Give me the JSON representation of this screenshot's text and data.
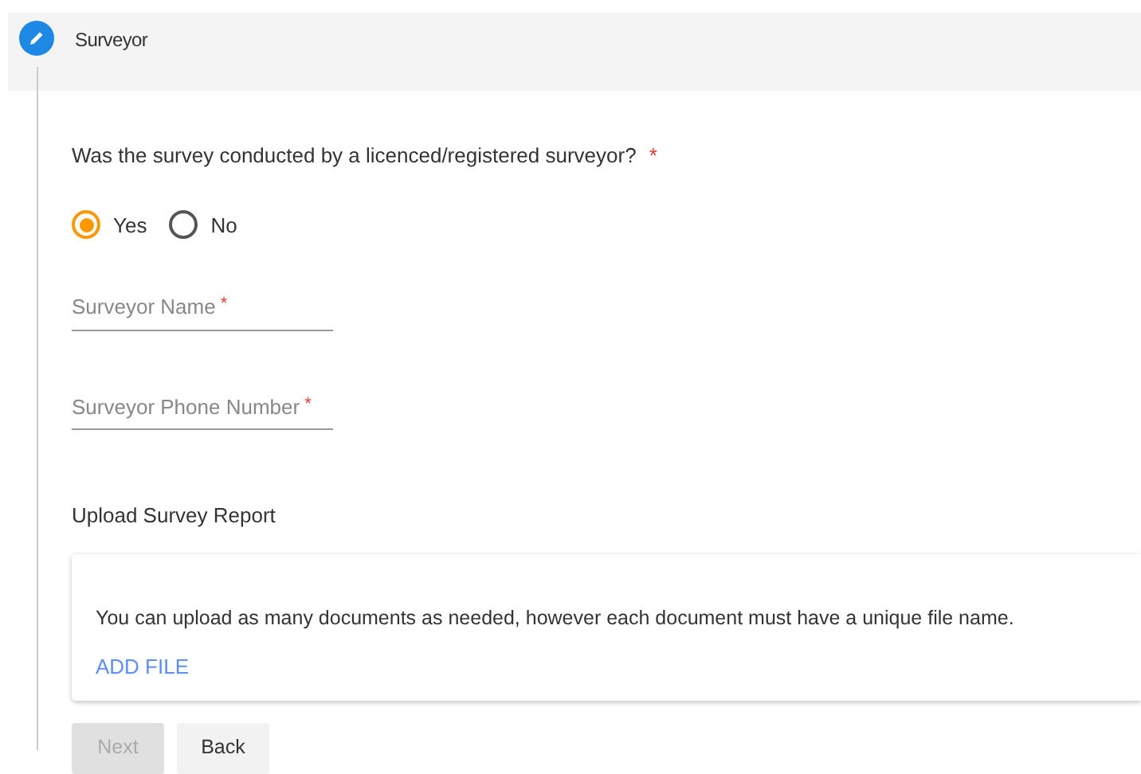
{
  "step": {
    "title": "Surveyor"
  },
  "question": {
    "label": "Was the survey conducted by a licenced/registered surveyor?",
    "required_mark": "*"
  },
  "options": [
    {
      "label": "Yes",
      "selected": true
    },
    {
      "label": "No",
      "selected": false
    }
  ],
  "fields": [
    {
      "placeholder": "Surveyor Name",
      "required_mark": "*"
    },
    {
      "placeholder": "Surveyor Phone Number",
      "required_mark": "*"
    }
  ],
  "upload": {
    "label": "Upload Survey Report",
    "note": "You can upload as many documents as needed, however each document must have a unique file name.",
    "action": "ADD FILE"
  },
  "buttons": [
    {
      "label": "Next",
      "disabled": true
    },
    {
      "label": "Back",
      "disabled": false
    }
  ]
}
